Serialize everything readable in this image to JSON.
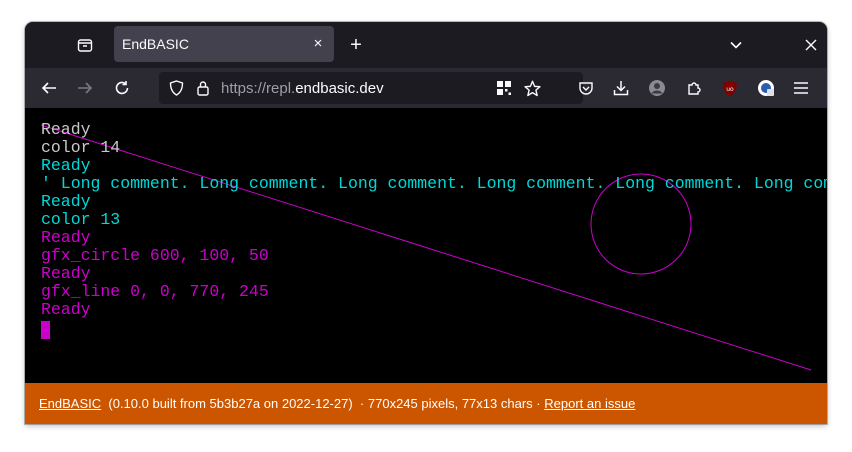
{
  "browser": {
    "tab_title": "EndBASIC",
    "tab_close": "×",
    "new_tab": "+",
    "url_prefix": "https://repl.",
    "url_host": "endbasic.dev"
  },
  "terminal": {
    "lines": [
      {
        "text": "Ready",
        "color": "#c8c8c8"
      },
      {
        "text": "color 14",
        "color": "#c8c8c8"
      },
      {
        "text": "Ready",
        "color": "#00d8d8"
      },
      {
        "text": "' Long comment. Long comment. Long comment. Long comment. Long comment. Long comment.",
        "color": "#00d8d8"
      },
      {
        "text": "Ready",
        "color": "#00d8d8"
      },
      {
        "text": "color 13",
        "color": "#00d8d8"
      },
      {
        "text": "Ready",
        "color": "#cc00cc"
      },
      {
        "text": "gfx_circle 600, 100, 50",
        "color": "#cc00cc"
      },
      {
        "text": "Ready",
        "color": "#cc00cc"
      },
      {
        "text": "gfx_line 0, 0, 770, 245",
        "color": "#cc00cc"
      },
      {
        "text": "Ready",
        "color": "#cc00cc"
      }
    ],
    "drawing_color": "#cc00cc"
  },
  "footer": {
    "app_link": "EndBASIC",
    "version_text": "(0.10.0 built from 5b3b27a on 2022-12-27)",
    "separator1": "·",
    "size_text": "770x245 pixels, 77x13 chars",
    "separator2": "·",
    "report_link": "Report an issue",
    "background": "#cc5500"
  }
}
